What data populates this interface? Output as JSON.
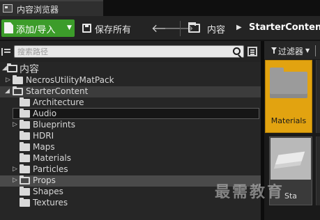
{
  "window": {
    "tab_title": "内容浏览器"
  },
  "toolbar": {
    "add_import_label": "添加/导入",
    "save_all_label": "保存所有",
    "back_arrow": "🡐",
    "forward_arrow": "🡒",
    "breadcrumb": [
      "内容",
      "StarterContent"
    ],
    "breadcrumb_separator": "▶"
  },
  "sources": {
    "search_placeholder": "搜索路径",
    "tree": [
      {
        "label": "内容",
        "depth": 0,
        "expanded": true,
        "state": "none"
      },
      {
        "label": "NecrosUtilityMatPack",
        "depth": 1,
        "expandable": true,
        "state": "none"
      },
      {
        "label": "StarterContent",
        "depth": 1,
        "expanded": true,
        "state": "selected"
      },
      {
        "label": "Architecture",
        "depth": 2,
        "expandable": false,
        "state": "none"
      },
      {
        "label": "Audio",
        "depth": 2,
        "expandable": false,
        "state": "focused"
      },
      {
        "label": "Blueprints",
        "depth": 2,
        "expandable": true,
        "state": "none"
      },
      {
        "label": "HDRI",
        "depth": 2,
        "expandable": false,
        "state": "none"
      },
      {
        "label": "Maps",
        "depth": 2,
        "expandable": false,
        "state": "none"
      },
      {
        "label": "Materials",
        "depth": 2,
        "expandable": false,
        "state": "none"
      },
      {
        "label": "Particles",
        "depth": 2,
        "expandable": true,
        "state": "none"
      },
      {
        "label": "Props",
        "depth": 2,
        "expandable": true,
        "state": "hovered"
      },
      {
        "label": "Shapes",
        "depth": 2,
        "expandable": false,
        "state": "none"
      },
      {
        "label": "Textures",
        "depth": 2,
        "expandable": false,
        "state": "none"
      }
    ]
  },
  "assets": {
    "filter_label": "过滤器",
    "items": [
      {
        "label": "Materials",
        "type": "folder",
        "selected": true
      },
      {
        "label": "Sta",
        "type": "static-mesh",
        "selected": false
      }
    ]
  },
  "watermark": "最需教育",
  "colors": {
    "accent_green": "#3c9c2a",
    "selection_orange": "#e2a310"
  }
}
